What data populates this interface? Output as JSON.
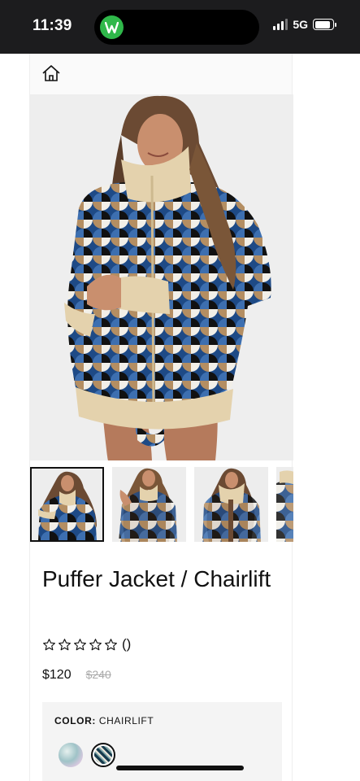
{
  "status_bar": {
    "time": "11:39",
    "network": "5G",
    "island_app_icon": "vimeo-w-icon",
    "battery_level": 0.9,
    "colors": {
      "bar": "#1c1c1e",
      "app_badge": "#2fb84a"
    }
  },
  "nav": {
    "home_icon": "home-icon"
  },
  "gallery": {
    "thumbnail_count": 4,
    "active_index": 0
  },
  "product": {
    "title": "Puffer Jacket / Chairlift",
    "rating": {
      "stars": 0,
      "max": 5,
      "count_text": "()"
    },
    "price": "$120",
    "compare_at_price": "$240"
  },
  "options": {
    "color_label": "COLOR:",
    "color_value": "CHAIRLIFT",
    "swatches": [
      "iridescent-swatch",
      "chairlift-swatch"
    ],
    "selected_swatch": 1
  }
}
